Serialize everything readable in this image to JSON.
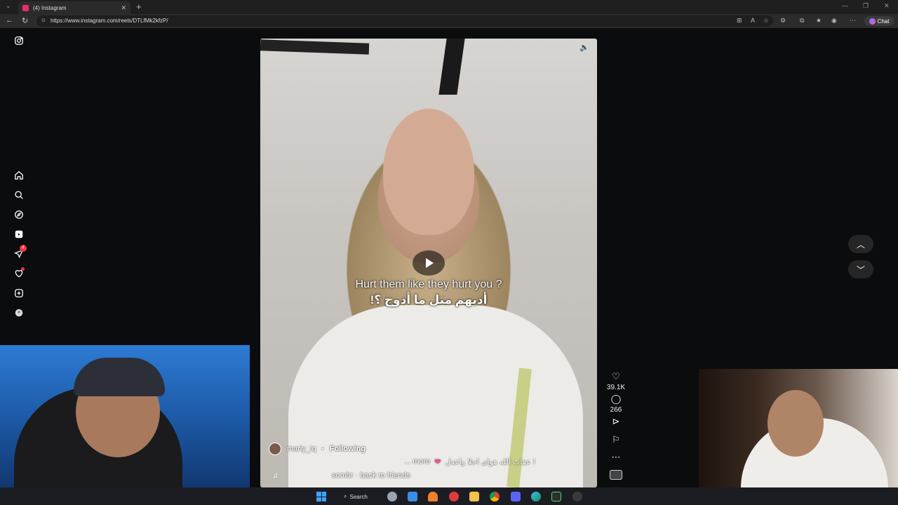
{
  "browser": {
    "tab_title": "(4) Instagram",
    "url": "https://www.instagram.com/reels/DTLfMk2kfzP/",
    "chat_label": "Chat",
    "colors": {
      "instagram_favicon": "#e1306c",
      "chrome_bg": "#1f1f1f"
    }
  },
  "sidebar": {
    "notification_count": "4",
    "items": [
      "instagram-logo-icon",
      "home-icon",
      "search-icon",
      "explore-icon",
      "reels-icon",
      "messages-icon",
      "notifications-icon",
      "create-icon",
      "profile-icon"
    ]
  },
  "reel": {
    "subtitle_en": "Hurt them like they hurt you ?",
    "subtitle_ar": "أذيهم مثل ما أذوج ؟!",
    "username": "mariy_iq",
    "separator": "•",
    "follow_status": "Following",
    "caption": "عقاب الله هواى احلا واعدل !",
    "caption_more": "... more",
    "audio": "sombr · back to friends"
  },
  "actions": {
    "likes": "39.1K",
    "comments": "266"
  },
  "taskbar": {
    "search_label": "Search"
  }
}
